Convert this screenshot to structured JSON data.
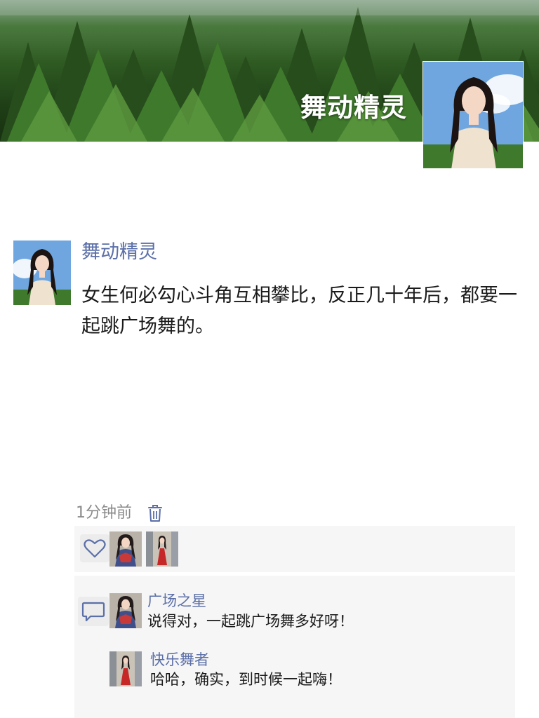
{
  "profile": {
    "cover_name": "舞动精灵",
    "cover_avatar_icon": "woman-portrait-avatar"
  },
  "post": {
    "author": "舞动精灵",
    "avatar_icon": "woman-portrait-avatar",
    "text": "女生何必勾心斗角互相攀比，反正几十年后，都要一起跳广场舞的。",
    "time": "1分钟前",
    "delete_icon": "trash-icon"
  },
  "likes": {
    "icon": "heart-icon",
    "users": [
      {
        "avatar_icon": "woman-in-costume-avatar"
      },
      {
        "avatar_icon": "woman-in-red-dress-avatar"
      }
    ]
  },
  "comments": {
    "icon": "comment-icon",
    "items": [
      {
        "author": "广场之星",
        "text": "说得对，一起跳广场舞多好呀！",
        "avatar_icon": "woman-in-costume-avatar"
      },
      {
        "author": "快乐舞者",
        "text": "哈哈，确实，到时候一起嗨！",
        "avatar_icon": "woman-in-red-dress-avatar"
      }
    ]
  },
  "colors": {
    "link_blue": "#5b6fa8",
    "panel_bg": "#f6f6f6",
    "text": "#1a1a1a",
    "muted": "#8a8a8a"
  }
}
